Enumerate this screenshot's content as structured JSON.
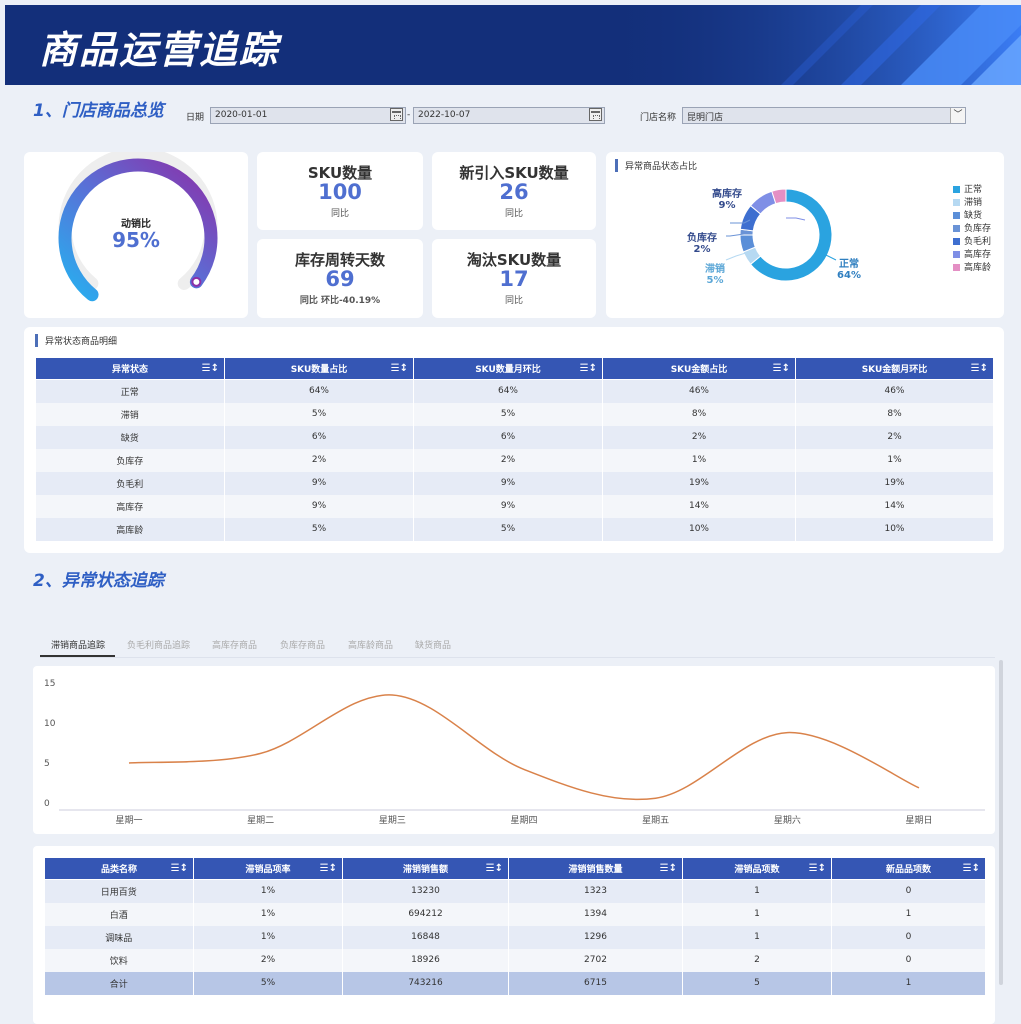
{
  "header": {
    "title": "商品运营追踪"
  },
  "section1": {
    "title": "1、门店商品总览"
  },
  "filters": {
    "date_label": "日期",
    "date_start": "2020-01-01",
    "date_sep": "-",
    "date_end": "2022-10-07",
    "store_label": "门店名称",
    "store_value": "昆明门店"
  },
  "gauge": {
    "label": "动销比",
    "value": "95%",
    "fraction": 0.95
  },
  "kpis": {
    "sku": {
      "title": "SKU数量",
      "value": "100",
      "sub": "同比"
    },
    "new_sku": {
      "title": "新引入SKU数量",
      "value": "26",
      "sub": "同比"
    },
    "turnover": {
      "title": "库存周转天数",
      "value": "69",
      "sub": "同比  环比-40.19%"
    },
    "eliminated": {
      "title": "淘汰SKU数量",
      "value": "17",
      "sub": "同比"
    }
  },
  "donut": {
    "title": "异常商品状态占比",
    "labels": {
      "high_stock": "高库存",
      "high_stock_pct": "9%",
      "neg_stock": "负库存",
      "neg_stock_pct": "2%",
      "slow": "滞销",
      "slow_pct": "5%",
      "normal": "正常",
      "normal_pct": "64%"
    },
    "legend": [
      {
        "name": "正常",
        "color": "#2aa3e0"
      },
      {
        "name": "滞销",
        "color": "#b6d9f2"
      },
      {
        "name": "缺货",
        "color": "#5b8fd8"
      },
      {
        "name": "负库存",
        "color": "#6a93d6"
      },
      {
        "name": "负毛利",
        "color": "#3e6fd0"
      },
      {
        "name": "高库存",
        "color": "#7f8fe6"
      },
      {
        "name": "高库龄",
        "color": "#e48fc4"
      }
    ],
    "slices": [
      {
        "name": "正常",
        "value": 64,
        "color": "#2aa3e0"
      },
      {
        "name": "滞销",
        "value": 5,
        "color": "#b6d9f2"
      },
      {
        "name": "缺货",
        "value": 6,
        "color": "#5b8fd8"
      },
      {
        "name": "负库存",
        "value": 2,
        "color": "#6a93d6"
      },
      {
        "name": "负毛利",
        "value": 9,
        "color": "#3e6fd0"
      },
      {
        "name": "高库存",
        "value": 9,
        "color": "#7f8fe6"
      },
      {
        "name": "高库龄",
        "value": 5,
        "color": "#e48fc4"
      }
    ]
  },
  "table1": {
    "title": "异常状态商品明细",
    "headers": [
      "异常状态",
      "SKU数量占比",
      "SKU数量月环比",
      "SKU金额占比",
      "SKU金额月环比"
    ],
    "rows": [
      [
        "正常",
        "64%",
        "64%",
        "46%",
        "46%"
      ],
      [
        "滞销",
        "5%",
        "5%",
        "8%",
        "8%"
      ],
      [
        "缺货",
        "6%",
        "6%",
        "2%",
        "2%"
      ],
      [
        "负库存",
        "2%",
        "2%",
        "1%",
        "1%"
      ],
      [
        "负毛利",
        "9%",
        "9%",
        "19%",
        "19%"
      ],
      [
        "高库存",
        "9%",
        "9%",
        "14%",
        "14%"
      ],
      [
        "高库龄",
        "5%",
        "5%",
        "10%",
        "10%"
      ]
    ]
  },
  "section2": {
    "title": "2、异常状态追踪"
  },
  "tabs": [
    "滞销商品追踪",
    "负毛利商品追踪",
    "高库存商品",
    "负库存商品",
    "高库龄商品",
    "缺货商品"
  ],
  "chart_data": {
    "type": "line",
    "categories": [
      "星期一",
      "星期二",
      "星期三",
      "星期四",
      "星期五",
      "星期六",
      "星期日"
    ],
    "series": [
      {
        "values": [
          5,
          6.2,
          13.5,
          4.2,
          0.6,
          8.8,
          1.9
        ],
        "color": "#d9824a"
      }
    ],
    "yticks": [
      "0",
      "5",
      "10",
      "15"
    ],
    "ylim": [
      0,
      15
    ],
    "grid": false,
    "title": "",
    "xlabel": "",
    "ylabel": ""
  },
  "table2": {
    "headers": [
      "品类名称",
      "滞销品项率",
      "滞销销售额",
      "滞销销售数量",
      "滞销品项数",
      "新品品项数"
    ],
    "rows": [
      [
        "日用百货",
        "1%",
        "13230",
        "1323",
        "1",
        "0"
      ],
      [
        "白酒",
        "1%",
        "694212",
        "1394",
        "1",
        "1"
      ],
      [
        "调味品",
        "1%",
        "16848",
        "1296",
        "1",
        "0"
      ],
      [
        "饮料",
        "2%",
        "18926",
        "2702",
        "2",
        "0"
      ]
    ],
    "total": [
      "合计",
      "5%",
      "743216",
      "6715",
      "5",
      "1"
    ]
  }
}
